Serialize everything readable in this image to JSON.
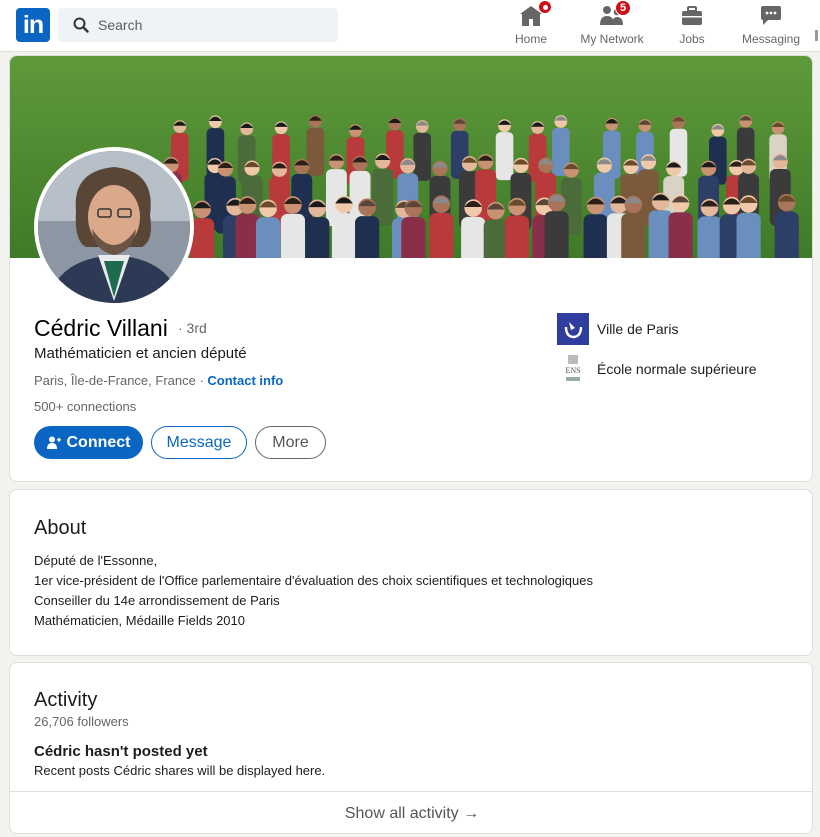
{
  "nav": {
    "logo_text": "in",
    "search_placeholder": "Search",
    "items": [
      {
        "label": "Home",
        "badge": ""
      },
      {
        "label": "My Network",
        "badge": "5"
      },
      {
        "label": "Jobs",
        "badge": ""
      },
      {
        "label": "Messaging",
        "badge": ""
      }
    ]
  },
  "profile": {
    "name": "Cédric Villani",
    "degree": "· 3rd",
    "headline": "Mathématicien et ancien député",
    "location": "Paris, Île-de-France, France",
    "location_sep": " · ",
    "contact_info": "Contact info",
    "connections": "500+ connections",
    "actions": {
      "connect": "Connect",
      "message": "Message",
      "more": "More"
    },
    "organizations": [
      {
        "name": "Ville de Paris",
        "logo": "ville-de-paris-logo"
      },
      {
        "name": "École normale supérieure",
        "logo": "ens-logo",
        "logo_text": "ENS"
      }
    ]
  },
  "about": {
    "title": "About",
    "lines": [
      "Député de l'Essonne,",
      "1er vice-président de l'Office parlementaire d'évaluation des choix scientifiques et technologiques",
      "Conseiller du 14e arrondissement de Paris",
      "Mathématicien, Médaille Fields 2010"
    ]
  },
  "activity": {
    "title": "Activity",
    "followers": "26,706 followers",
    "empty_title": "Cédric hasn't posted yet",
    "empty_subtitle": "Recent posts Cédric shares will be displayed here.",
    "show_all": "Show all activity →"
  },
  "colors": {
    "brand": "#0a66c2",
    "badge": "#cc1016",
    "page_bg": "#f3f2ef"
  }
}
